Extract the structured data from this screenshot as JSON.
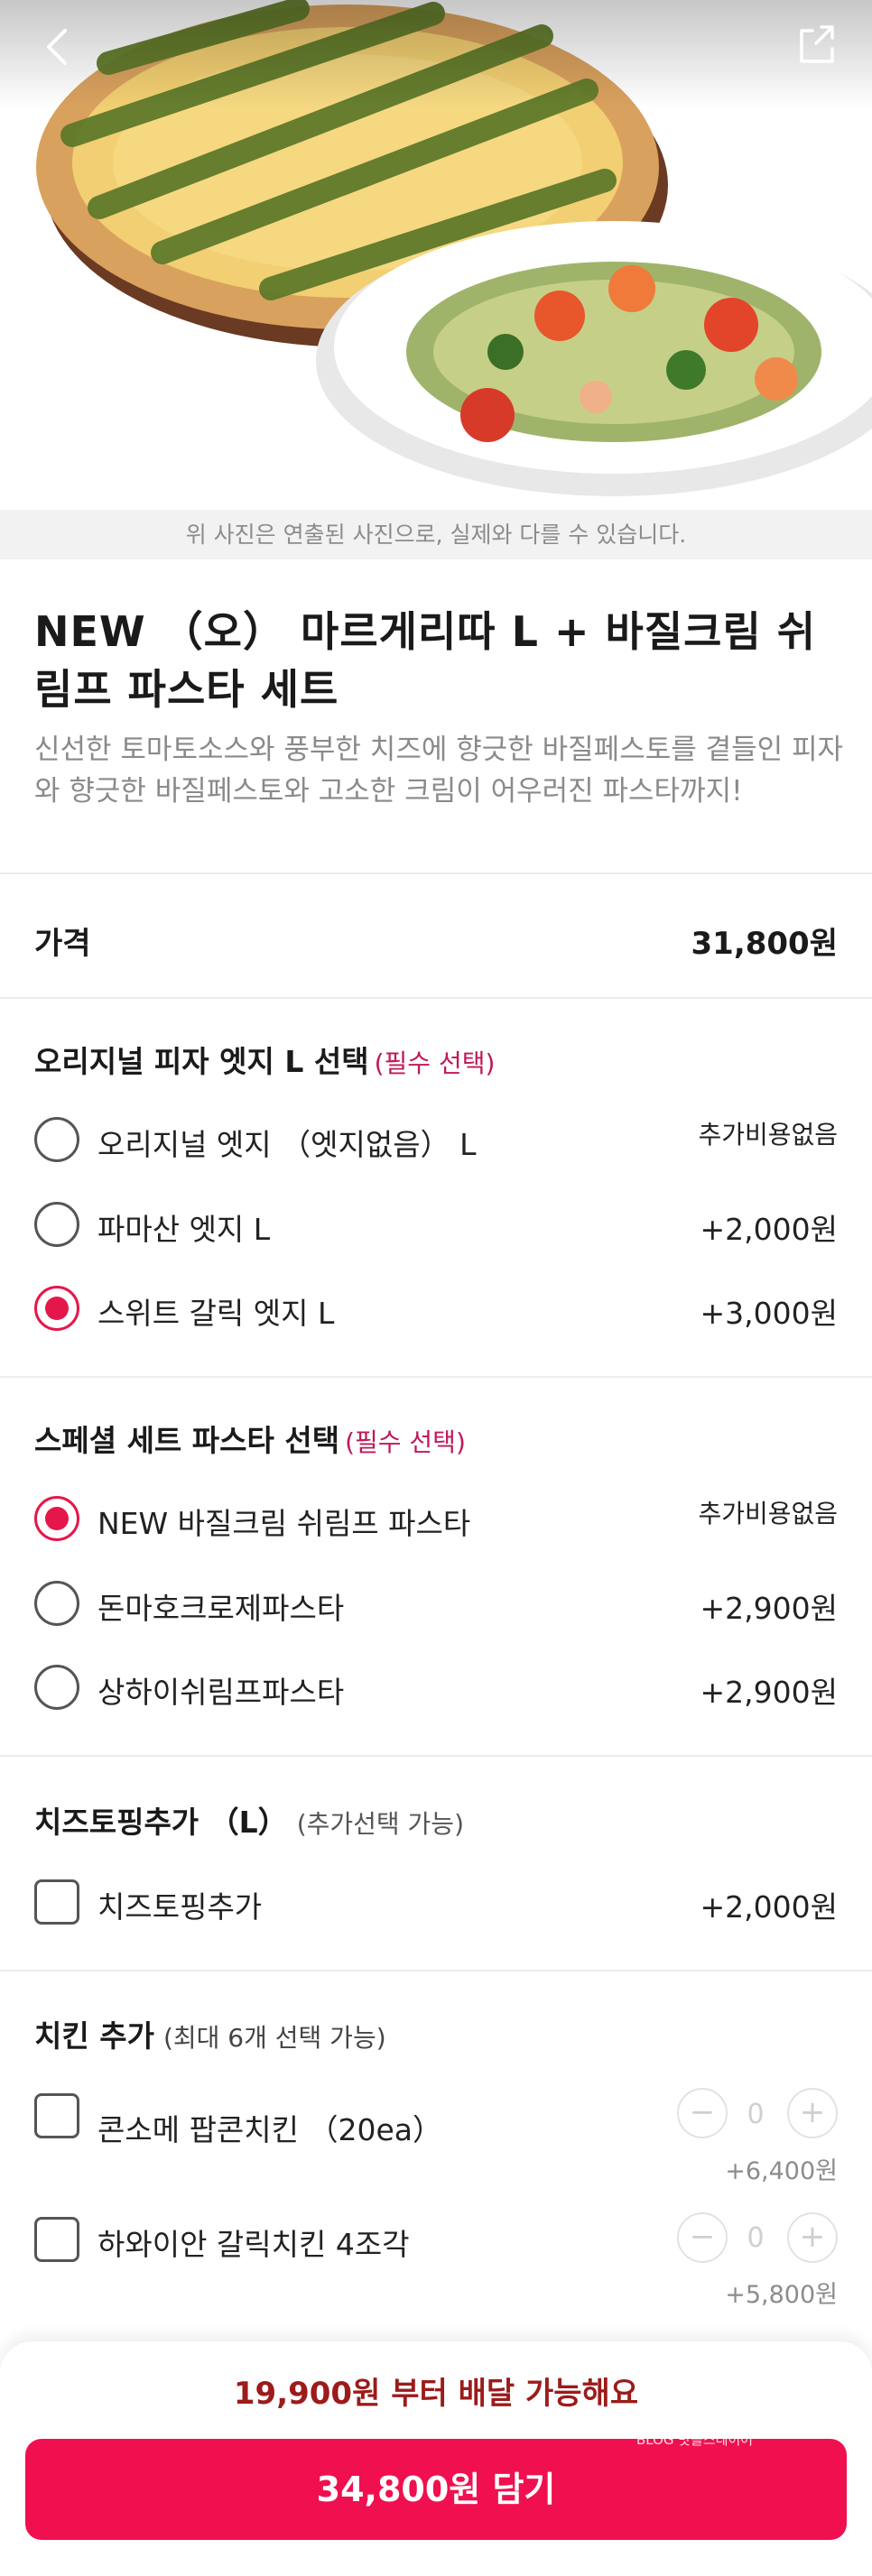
{
  "hero": {
    "caption": "위 사진은 연출된 사진으로, 실제와 다를 수 있습니다."
  },
  "product": {
    "title": "NEW （오） 마르게리따 L + 바질크림 쉬림프 파스타 세트",
    "description": "신선한 토마토소스와 풍부한 치즈에 향긋한 바질페스토를 곁들인 피자와 향긋한 바질페스토와 고소한 크림이 어우러진 파스타까지!"
  },
  "price_row": {
    "label": "가격",
    "value": "31,800원"
  },
  "edge_section": {
    "title": "오리지널 피자 엣지 L 선택",
    "required": "(필수 선택)",
    "options": [
      {
        "label": "오리지널 엣지 （엣지없음） L",
        "price": "추가비용없음",
        "selected": false
      },
      {
        "label": "파마산 엣지 L",
        "price": "+2,000원",
        "selected": false
      },
      {
        "label": "스위트 갈릭 엣지 L",
        "price": "+3,000원",
        "selected": true
      }
    ]
  },
  "pasta_section": {
    "title": "스페셜 세트 파스타 선택",
    "required": "(필수 선택)",
    "options": [
      {
        "label": "NEW 바질크림 쉬림프 파스타",
        "price": "추가비용없음",
        "selected": true
      },
      {
        "label": "돈마호크로제파스타",
        "price": "+2,900원",
        "selected": false
      },
      {
        "label": "상하이쉬림프파스타",
        "price": "+2,900원",
        "selected": false
      }
    ]
  },
  "cheese_section": {
    "title": "치즈토핑추가 （L）",
    "note": "(추가선택 가능)",
    "options": [
      {
        "label": "치즈토핑추가",
        "price": "+2,000원",
        "checked": false
      }
    ]
  },
  "chicken_section": {
    "title": "치킨 추가",
    "note": "(최대 6개 선택 가능)",
    "options": [
      {
        "label": "콘소메 팝콘치킨 （20ea）",
        "quantity": "0",
        "price": "+6,400원",
        "checked": false
      },
      {
        "label": "하와이안 갈릭치킨 4조각",
        "quantity": "0",
        "price": "+5,800원",
        "checked": false
      }
    ]
  },
  "bottom": {
    "min_delivery": "19,900원 부터 배달 가능해요",
    "add_button": "34,800원 담기",
    "watermark": "BLOG 맛을스레이어"
  },
  "colors": {
    "accent": "#f0104f",
    "required": "#c0185a",
    "min_delivery": "#9c1b1b"
  },
  "icons": {
    "back": "chevron-left-icon",
    "share": "share-icon"
  }
}
